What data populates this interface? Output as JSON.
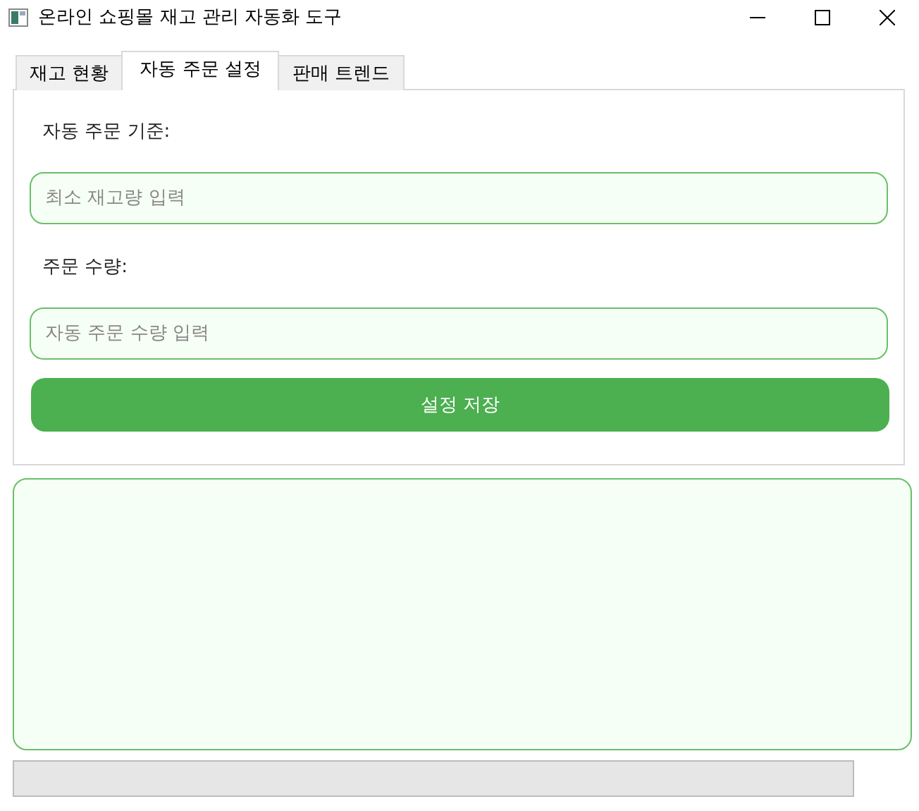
{
  "window": {
    "title": "온라인 쇼핑몰 재고 관리 자동화 도구"
  },
  "tabs": [
    {
      "label": "재고 현황",
      "selected": false
    },
    {
      "label": "자동 주문 설정",
      "selected": true
    },
    {
      "label": "판매 트렌드",
      "selected": false
    }
  ],
  "form": {
    "fields": [
      {
        "label": "자동 주문 기준:",
        "placeholder": "최소 재고량 입력"
      },
      {
        "label": "주문 수량:",
        "placeholder": "자동 주문 수량 입력"
      }
    ],
    "button": "설정 저장"
  },
  "progress": {
    "level": 0
  }
}
